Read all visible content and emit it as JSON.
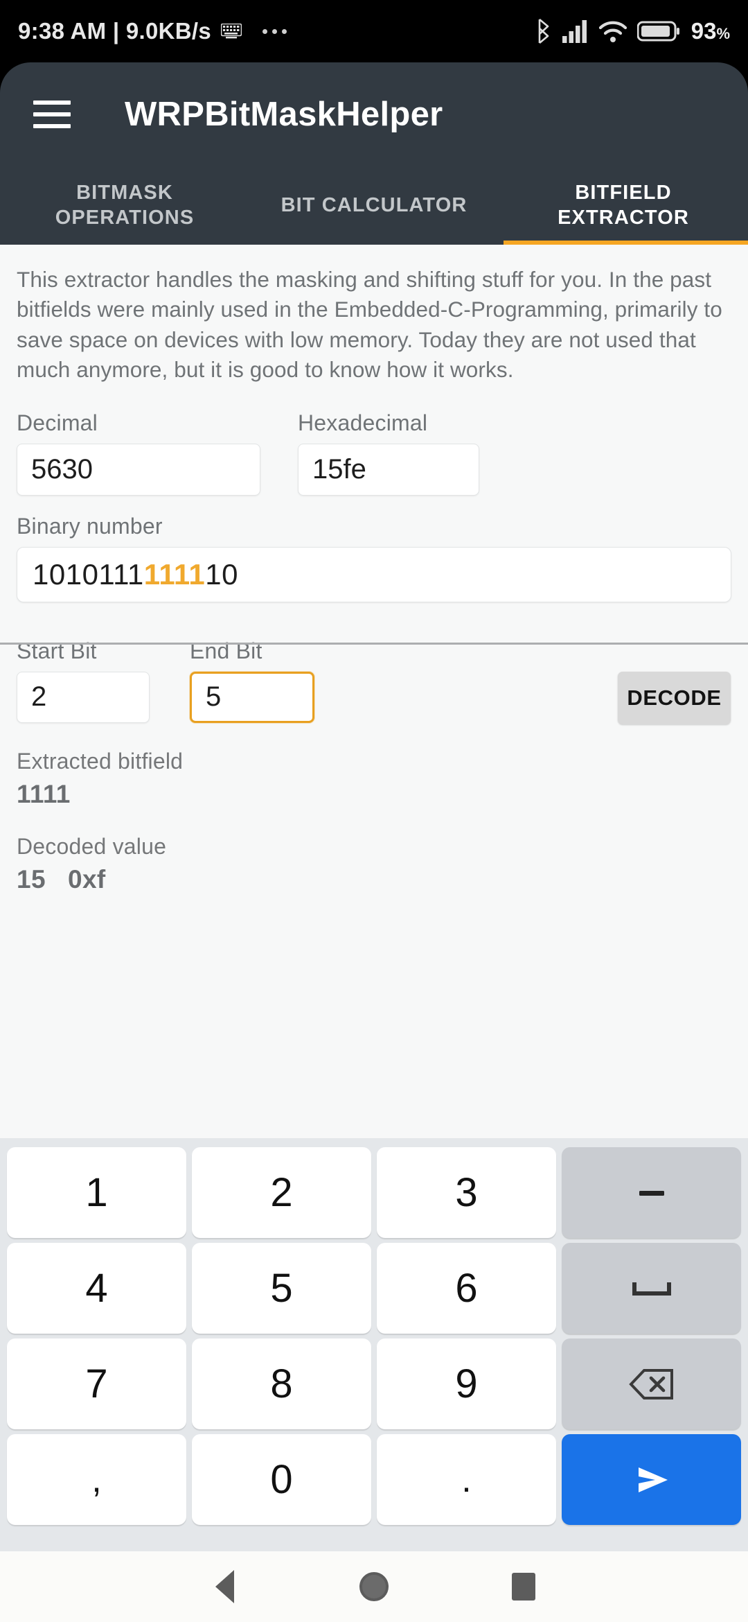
{
  "statusbar": {
    "clock": "9:38 AM | 9.0KB/s",
    "keyboard_icon": "keyboard-icon",
    "overflow_icon": "more-dots-icon",
    "bluetooth_icon": "bluetooth-icon",
    "signal_icon": "cellular-signal-icon",
    "wifi_icon": "wifi-icon",
    "battery_icon": "battery-icon",
    "battery_level": "93",
    "battery_unit": "%"
  },
  "appbar": {
    "menu_icon": "hamburger-menu-icon",
    "title": "WRPBitMaskHelper",
    "background": "#323a42"
  },
  "tabs": {
    "accent": "#F5A623",
    "items": [
      {
        "label": "BITMASK OPERATIONS",
        "active": false
      },
      {
        "label": "BIT CALCULATOR",
        "active": false
      },
      {
        "label": "BITFIELD EXTRACTOR",
        "active": true
      }
    ]
  },
  "main": {
    "description": "This extractor handles the masking and shifting stuff for you. In the past bitfields were mainly used in the Embedded-C-Programming, primarily to save space on devices with low memory. Today they are not used that much anymore, but it is good to know how it works.",
    "decimal": {
      "label": "Decimal",
      "value": "5630"
    },
    "hexadecimal": {
      "label": "Hexadecimal",
      "value": "15fe"
    },
    "binary": {
      "label": "Binary number",
      "prefix": "1010111",
      "highlight": "1111",
      "suffix": "10",
      "highlight_color": "#F0A92E"
    },
    "start_bit": {
      "label": "Start Bit",
      "value": "2",
      "focused": false
    },
    "end_bit": {
      "label": "End Bit",
      "value": "5",
      "focused": true,
      "focus_color": "#E8A020"
    },
    "decode_button": {
      "label": "DECODE",
      "background": "#d9d9d9"
    },
    "extracted": {
      "label": "Extracted bitfield",
      "value": "1111"
    },
    "decoded": {
      "label": "Decoded value",
      "value": "15",
      "hex": "0xf"
    }
  },
  "keyboard": {
    "background": "#e4e7ea",
    "send_color": "#1a73e8",
    "rows": [
      [
        {
          "label": "1",
          "name": "key-1",
          "type": "digit"
        },
        {
          "label": "2",
          "name": "key-2",
          "type": "digit"
        },
        {
          "label": "3",
          "name": "key-3",
          "type": "digit"
        },
        {
          "label": "–",
          "name": "key-minus",
          "type": "fn"
        }
      ],
      [
        {
          "label": "4",
          "name": "key-4",
          "type": "digit"
        },
        {
          "label": "5",
          "name": "key-5",
          "type": "digit"
        },
        {
          "label": "6",
          "name": "key-6",
          "type": "digit"
        },
        {
          "label": "␣",
          "name": "key-space",
          "type": "fn"
        }
      ],
      [
        {
          "label": "7",
          "name": "key-7",
          "type": "digit"
        },
        {
          "label": "8",
          "name": "key-8",
          "type": "digit"
        },
        {
          "label": "9",
          "name": "key-9",
          "type": "digit"
        },
        {
          "label": "⌫",
          "name": "key-backspace",
          "type": "fn"
        }
      ],
      [
        {
          "label": ",",
          "name": "key-comma",
          "type": "punct"
        },
        {
          "label": "0",
          "name": "key-0",
          "type": "digit"
        },
        {
          "label": ".",
          "name": "key-period",
          "type": "punct"
        },
        {
          "label": "➤",
          "name": "key-send",
          "type": "send"
        }
      ]
    ]
  },
  "navbar": {
    "back": "back-triangle-icon",
    "home": "home-circle-icon",
    "recents": "recents-square-icon"
  }
}
